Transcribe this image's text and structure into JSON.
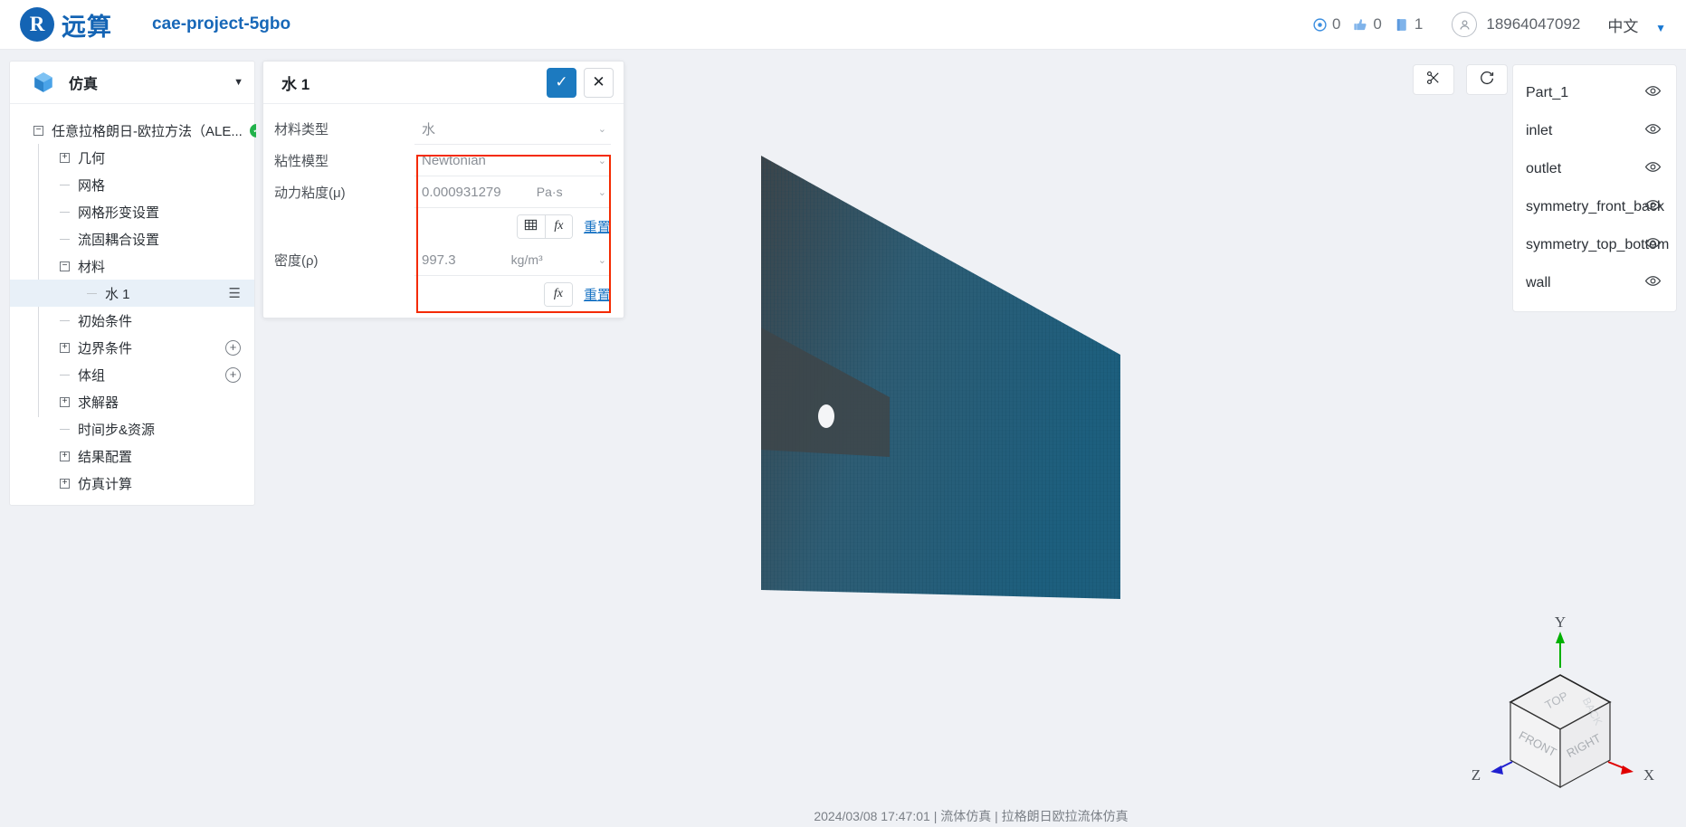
{
  "header": {
    "brand": "远算",
    "project": "cae-project-5gbo",
    "stats": [
      {
        "icon": "eye-icon",
        "value": "0"
      },
      {
        "icon": "thumbs-up-icon",
        "value": "0"
      },
      {
        "icon": "book-icon",
        "value": "1"
      }
    ],
    "user": "18964047092",
    "language": "中文"
  },
  "sidebar": {
    "title": "仿真",
    "icon": "cube-icon",
    "tree": [
      {
        "label": "任意拉格朗日-欧拉方法（ALE...",
        "toggle": "minus",
        "depth": 0,
        "status": "ok"
      },
      {
        "label": "几何",
        "toggle": "plus",
        "depth": 1
      },
      {
        "label": "网格",
        "toggle": "dash",
        "depth": 1
      },
      {
        "label": "网格形变设置",
        "toggle": "dash",
        "depth": 1
      },
      {
        "label": "流固耦合设置",
        "toggle": "dash",
        "depth": 1
      },
      {
        "label": "材料",
        "toggle": "minus",
        "depth": 1
      },
      {
        "label": "水 1",
        "toggle": "dash",
        "depth": 2,
        "selected": true,
        "trailing": "menu-icon"
      },
      {
        "label": "初始条件",
        "toggle": "dash",
        "depth": 1
      },
      {
        "label": "边界条件",
        "toggle": "plus",
        "depth": 1,
        "trailing": "add-icon"
      },
      {
        "label": "体组",
        "toggle": "dash",
        "depth": 1,
        "trailing": "add-icon"
      },
      {
        "label": "求解器",
        "toggle": "plus",
        "depth": 1
      },
      {
        "label": "时间步&资源",
        "toggle": "dash",
        "depth": 1
      },
      {
        "label": "结果配置",
        "toggle": "plus",
        "depth": 1
      },
      {
        "label": "仿真计算",
        "toggle": "plus",
        "depth": 1
      }
    ]
  },
  "dialog": {
    "title": "水 1",
    "confirm_icon": "check-icon",
    "cancel_icon": "close-icon",
    "fields": [
      {
        "label": "材料类型",
        "value": "水",
        "control": "select"
      },
      {
        "label": "粘性模型",
        "value": "Newtonian",
        "control": "select"
      },
      {
        "label": "动力粘度(μ)",
        "value": "0.000931279",
        "unit": "Pa·s",
        "control": "input-unit"
      },
      {
        "label": "密度(ρ)",
        "value": "997.3",
        "unit": "kg/m³",
        "control": "input-unit"
      }
    ],
    "viscosity_tools": {
      "table_icon": "table-icon",
      "fx_icon": "fx-icon",
      "reset": "重置"
    },
    "density_tools": {
      "fx_icon": "fx-icon",
      "reset": "重置"
    }
  },
  "viewport": {
    "tools": [
      {
        "name": "clip-plane",
        "icon": "scissors-icon"
      },
      {
        "name": "reset-view",
        "icon": "refresh-icon"
      }
    ],
    "parts": [
      {
        "label": "Part_1",
        "visibility_icon": "eye-icon"
      },
      {
        "label": "inlet",
        "visibility_icon": "eye-icon"
      },
      {
        "label": "outlet",
        "visibility_icon": "eye-icon"
      },
      {
        "label": "symmetry_front_back",
        "visibility_icon": "eye-icon"
      },
      {
        "label": "symmetry_top_bottom",
        "visibility_icon": "eye-icon"
      },
      {
        "label": "wall",
        "visibility_icon": "eye-icon"
      }
    ],
    "nav_cube": {
      "faces": {
        "top": "TOP",
        "front": "FRONT",
        "right": "RIGHT",
        "back": "BACK"
      },
      "axes": {
        "x": "X",
        "y": "Y",
        "z": "Z"
      },
      "axis_colors": {
        "x": "#e00000",
        "y": "#00b000",
        "z": "#2020d0"
      }
    },
    "mesh_color": "#2b5f77"
  },
  "status_bar": "2024/03/08  17:47:01  |  流体仿真  |  拉格朗日欧拉流体仿真",
  "colors": {
    "accent": "#1c7ac0",
    "brand": "#1464b4",
    "highlight_box": "#f42a00",
    "ok_green": "#21b24b"
  }
}
